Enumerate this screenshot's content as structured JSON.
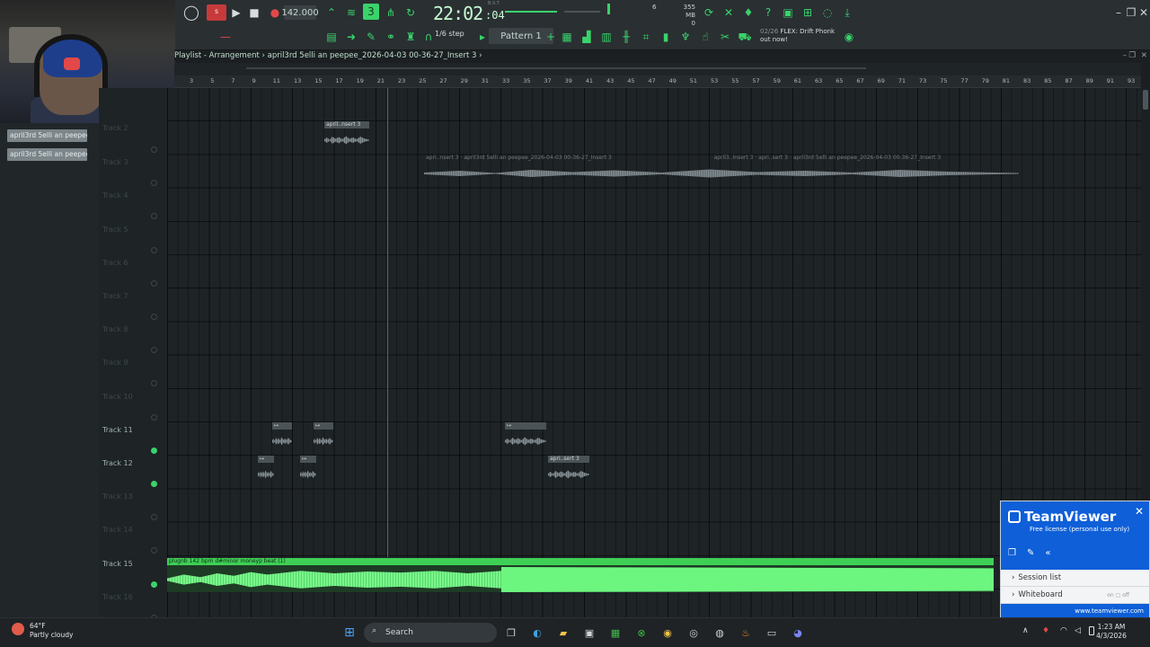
{
  "toolbar": {
    "tempo": "142.000",
    "time": "22:02",
    "time_sub": ":04",
    "bst_label": "B:S:T",
    "cpu": "6",
    "memory_top": "355 MB",
    "memory_bottom": "0",
    "snap": "1/6 step",
    "pattern": "Pattern 1",
    "news_date": "02/26",
    "news_text": "FLEX: Drift Phonk out now!"
  },
  "playlist": {
    "title": "Playlist - Arrangement",
    "separator": "›",
    "clip_name": "april3rd 5elli an peepee_2026-04-03 00-36-27_Insert 3",
    "ruler": [
      "3",
      "5",
      "7",
      "9",
      "11",
      "13",
      "15",
      "17",
      "19",
      "21",
      "23",
      "25",
      "27",
      "29",
      "31",
      "33",
      "35",
      "37",
      "39",
      "41",
      "43",
      "45",
      "47",
      "49",
      "51",
      "53",
      "55",
      "57",
      "59",
      "61",
      "63",
      "65",
      "67",
      "69",
      "71",
      "73",
      "75",
      "77",
      "79",
      "81",
      "83",
      "85",
      "87",
      "89",
      "91",
      "93"
    ],
    "tracks": [
      "Track 2",
      "Track 3",
      "Track 4",
      "Track 5",
      "Track 6",
      "Track 7",
      "Track 8",
      "Track 9",
      "Track 10",
      "Track 11",
      "Track 12",
      "Track 13",
      "Track 14",
      "Track 15",
      "Track 16"
    ]
  },
  "picker": [
    "april3rd 5elli an peepee_",
    "april3rd 5elli an peepee_"
  ],
  "clips": {
    "small1": "april..nsert 3",
    "big1": "apri..nsert 3",
    "big2": "april3rd 5elli an peepee_2026-04-03 00-36-27_Insert 3",
    "big3": "april3..Insert 3",
    "big4": "apri..sert 3",
    "big5": "april3rd 5elli an peepee_2026-04-03 00-36-27_Insert 3",
    "t12": "apri..sert 3",
    "green": "plugnb 142 bpm d#minor moneyp beat (1)"
  },
  "teamviewer": {
    "name": "TeamViewer",
    "license": "Free license (personal use only)",
    "session": "Session list",
    "whiteboard": "Whiteboard",
    "toggle_on": "on",
    "toggle_off": "off",
    "url": "www.teamviewer.com"
  },
  "taskbar": {
    "temp": "64°F",
    "weather": "Partly cloudy",
    "search": "Search",
    "time": "1:23 AM",
    "date": "4/3/2026"
  },
  "colors": {
    "accent": "#39d36b",
    "teamviewer": "#0e5fd8",
    "audio_green": "#6cf67f"
  }
}
